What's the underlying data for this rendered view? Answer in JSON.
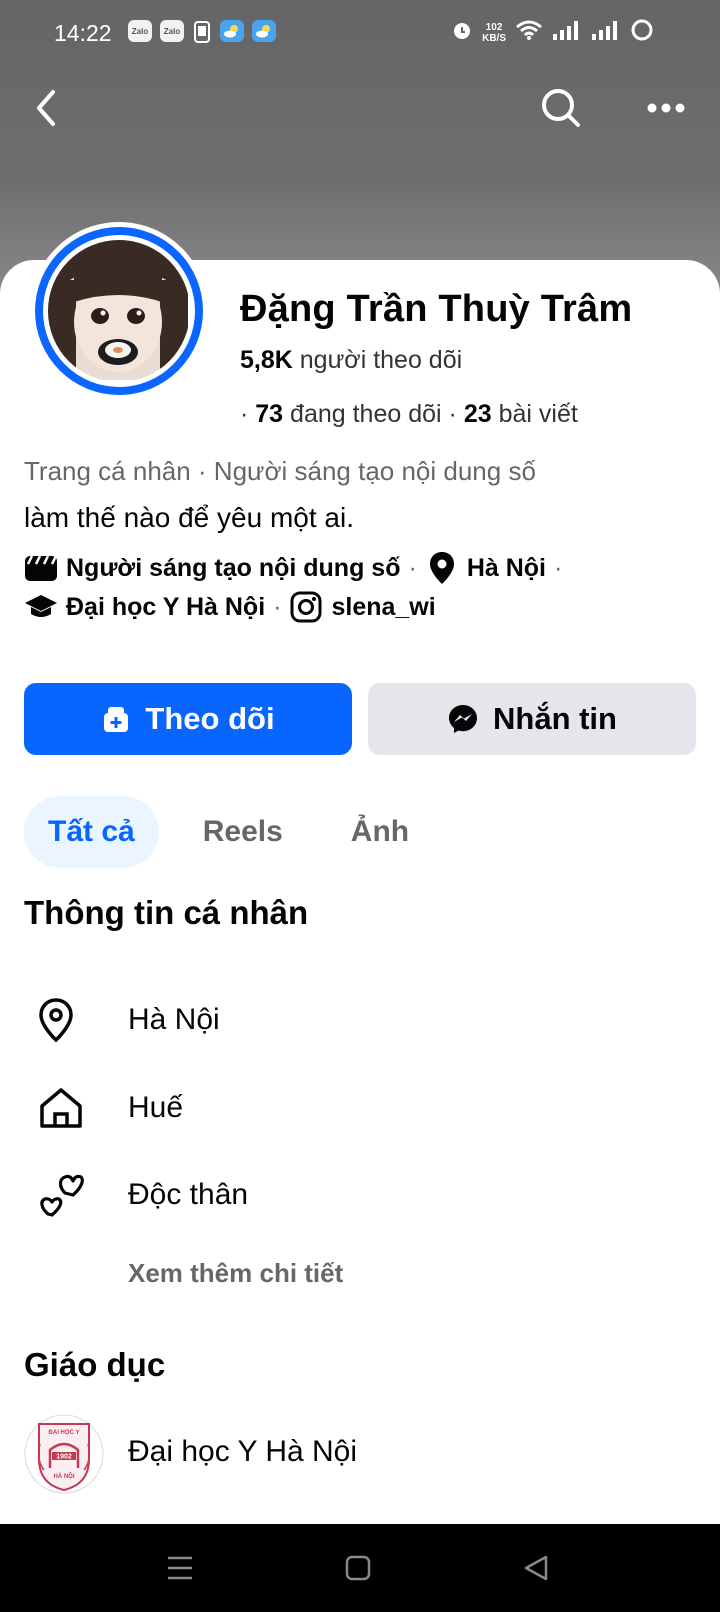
{
  "status_bar": {
    "time": "14:22",
    "left_icons": [
      "Zalo",
      "Zalo"
    ],
    "net_speed_value": "102",
    "net_speed_unit": "KB/S"
  },
  "nav": {
    "back_icon": "chevron-left-icon",
    "search_icon": "search-icon",
    "more_icon": "more-dots-icon"
  },
  "profile": {
    "name": "Đặng Trần Thuỳ Trâm",
    "followers_count": "5,8K",
    "followers_label": "người theo dõi",
    "following_count": "73",
    "following_label": "đang theo dõi",
    "posts_count": "23",
    "posts_label": "bài viết",
    "category_line": "Trang cá nhân · Người sáng tạo nội dung số",
    "bio": "làm thế nào để yêu một ai."
  },
  "details": {
    "creator": "Người sáng tạo nội dung số",
    "location": "Hà Nội",
    "school": "Đại học Y Hà Nội",
    "instagram": "slena_wi"
  },
  "actions": {
    "follow_label": "Theo dõi",
    "message_label": "Nhắn tin",
    "accent": "#0866ff"
  },
  "tabs": [
    {
      "label": "Tất cả",
      "active": true
    },
    {
      "label": "Reels",
      "active": false
    },
    {
      "label": "Ảnh",
      "active": false
    }
  ],
  "personal_info": {
    "title": "Thông tin cá nhân",
    "items": [
      {
        "icon": "location-pin-icon",
        "text": "Hà Nội"
      },
      {
        "icon": "home-icon",
        "text": "Huế"
      },
      {
        "icon": "hearts-icon",
        "text": "Độc thân"
      }
    ],
    "see_more": "Xem thêm chi tiết"
  },
  "education": {
    "title": "Giáo dục",
    "school": "Đại học Y Hà Nội",
    "logo_text_top": "ĐẠI HỌC Y",
    "logo_year": "1902",
    "logo_text_bottom": "HÀ NỘI"
  }
}
